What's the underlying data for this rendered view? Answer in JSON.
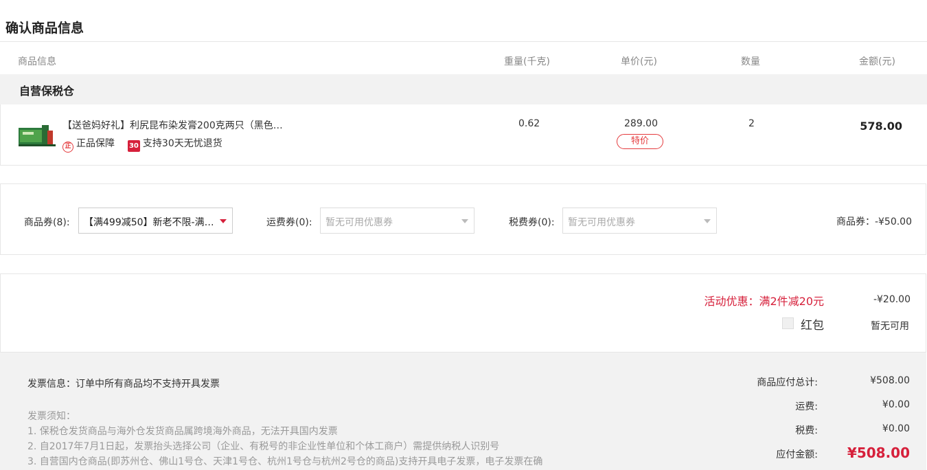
{
  "page_title": "确认商品信息",
  "table_headers": {
    "product": "商品信息",
    "weight": "重量(千克)",
    "price": "单价(元)",
    "quantity": "数量",
    "amount": "金额(元)"
  },
  "warehouse": "自营保税仓",
  "item": {
    "title": "【送爸妈好礼】利尻昆布染发膏200克两只（黑色…",
    "badge_genuine_icon": "正",
    "badge_genuine": "正品保障",
    "badge_return_icon": "30",
    "badge_return": "支持30天无忧退货",
    "weight": "0.62",
    "price": "289.00",
    "price_tag": "特价",
    "quantity": "2",
    "amount": "578.00"
  },
  "coupons": {
    "goods_label": "商品券(8):",
    "goods_selected": "【满499减50】新老不限-满…",
    "shipping_label": "运费券(0):",
    "shipping_selected": "暂无可用优惠券",
    "tax_label": "税费券(0):",
    "tax_selected": "暂无可用优惠券",
    "total_label": "商品券：-¥50.00"
  },
  "promotion": {
    "label": "活动优惠：满2件减20元",
    "value": "-¥20.00",
    "redpack_label": "红包",
    "redpack_value": "暂无可用"
  },
  "invoice": {
    "info": "发票信息：订单中所有商品均不支持开具发票",
    "notes_title": "发票须知：",
    "notes": [
      "1. 保税仓发货商品与海外仓发货商品属跨境海外商品，无法开具国内发票",
      "2. 自2017年7月1日起，发票抬头选择公司（企业、有税号的非企业性单位和个体工商户）需提供纳税人识别号",
      "3. 自营国内仓商品(即苏州仓、佛山1号仓、天津1号仓、杭州1号仓与杭州2号仓的商品)支持开具电子发票，电子发票在确"
    ]
  },
  "summary": {
    "subtotal_label": "商品应付总计:",
    "subtotal": "¥508.00",
    "shipping_label": "运费:",
    "shipping": "¥0.00",
    "tax_label": "税费:",
    "tax": "¥0.00",
    "payable_label": "应付金额:",
    "payable": "¥508.00"
  },
  "colors": {
    "accent": "#d6203b",
    "panel_bg": "#f2f2f2",
    "border": "#e6e6e6"
  },
  "icons": {
    "thumb": "product-thumbnail",
    "genuine": "genuine-badge-icon",
    "return": "30-day-return-icon",
    "caret": "chevron-down-icon"
  }
}
